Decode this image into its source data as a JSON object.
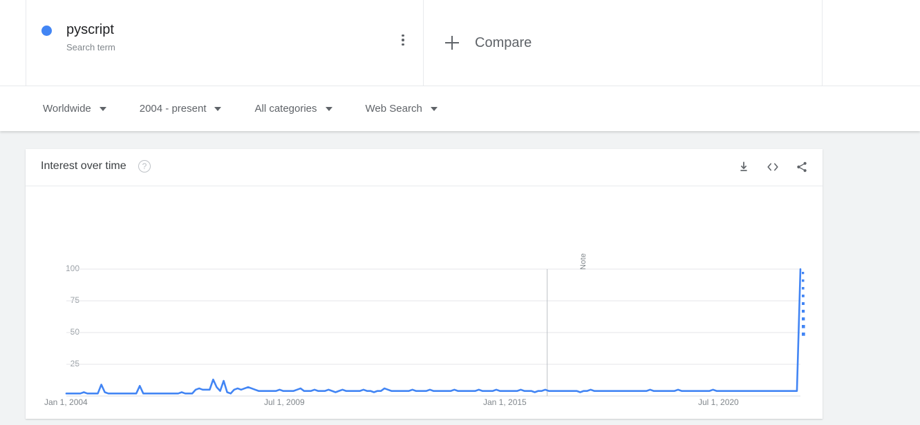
{
  "terms": {
    "items": [
      {
        "name": "pyscript",
        "type": "Search term",
        "color": "#4285f4",
        "menu_icon": "more-vert-icon"
      }
    ],
    "compare_label": "Compare",
    "compare_icon": "plus-icon"
  },
  "filters": [
    {
      "name": "location",
      "label": "Worldwide",
      "caret_icon": "chevron-down-icon"
    },
    {
      "name": "time-range",
      "label": "2004 - present",
      "caret_icon": "chevron-down-icon"
    },
    {
      "name": "category",
      "label": "All categories",
      "caret_icon": "chevron-down-icon"
    },
    {
      "name": "search-type",
      "label": "Web Search",
      "caret_icon": "chevron-down-icon"
    }
  ],
  "card": {
    "title": "Interest over time",
    "help_icon": "help-circle-icon",
    "help_glyph": "?",
    "actions": [
      {
        "name": "download-button",
        "icon": "download-icon"
      },
      {
        "name": "embed-button",
        "icon": "code-brackets-icon"
      },
      {
        "name": "share-button",
        "icon": "share-icon"
      }
    ]
  },
  "chart_data": {
    "type": "line",
    "title": "Interest over time",
    "xlabel": "",
    "ylabel": "",
    "ylim": [
      0,
      100
    ],
    "grid": true,
    "legend_position": "top",
    "line_color": "#4285f4",
    "gridline_color": "#e4e6e8",
    "y_ticks": [
      100,
      75,
      50,
      25
    ],
    "x_ticks": [
      "Jan 1, 2004",
      "Jul 1, 2009",
      "Jan 1, 2015",
      "Jul 1, 2020"
    ],
    "x_tick_positions": [
      0,
      0.305,
      0.608,
      0.905
    ],
    "annotations": [
      {
        "name": "note-marker",
        "label": "Note",
        "x_fraction": 0.655
      }
    ],
    "series": [
      {
        "name": "pyscript",
        "values": [
          2,
          2,
          2,
          2,
          2,
          3,
          2,
          2,
          2,
          2,
          9,
          3,
          2,
          2,
          2,
          2,
          2,
          2,
          2,
          2,
          2,
          8,
          2,
          2,
          2,
          2,
          2,
          2,
          2,
          2,
          2,
          2,
          2,
          3,
          2,
          2,
          2,
          5,
          6,
          5,
          5,
          5,
          13,
          7,
          4,
          12,
          3,
          2,
          5,
          6,
          5,
          6,
          7,
          6,
          5,
          4,
          4,
          4,
          4,
          4,
          4,
          5,
          4,
          4,
          4,
          4,
          5,
          6,
          4,
          4,
          4,
          5,
          4,
          4,
          4,
          5,
          4,
          3,
          4,
          5,
          4,
          4,
          4,
          4,
          4,
          5,
          4,
          4,
          3,
          4,
          4,
          6,
          5,
          4,
          4,
          4,
          4,
          4,
          4,
          5,
          4,
          4,
          4,
          4,
          5,
          4,
          4,
          4,
          4,
          4,
          4,
          5,
          4,
          4,
          4,
          4,
          4,
          4,
          5,
          4,
          4,
          4,
          4,
          5,
          4,
          4,
          4,
          4,
          4,
          4,
          5,
          4,
          4,
          4,
          3,
          4,
          4,
          5,
          4,
          4,
          4,
          4,
          4,
          4,
          4,
          4,
          4,
          3,
          4,
          4,
          5,
          4,
          4,
          4,
          4,
          4,
          4,
          4,
          4,
          4,
          4,
          4,
          4,
          4,
          4,
          4,
          4,
          5,
          4,
          4,
          4,
          4,
          4,
          4,
          4,
          5,
          4,
          4,
          4,
          4,
          4,
          4,
          4,
          4,
          4,
          5,
          4,
          4,
          4,
          4,
          4,
          4,
          4,
          4,
          4,
          4,
          4,
          4,
          4,
          4,
          4,
          4,
          4,
          4,
          4,
          4,
          4,
          4,
          4,
          4,
          100
        ],
        "partial_data_marker": true
      }
    ]
  }
}
